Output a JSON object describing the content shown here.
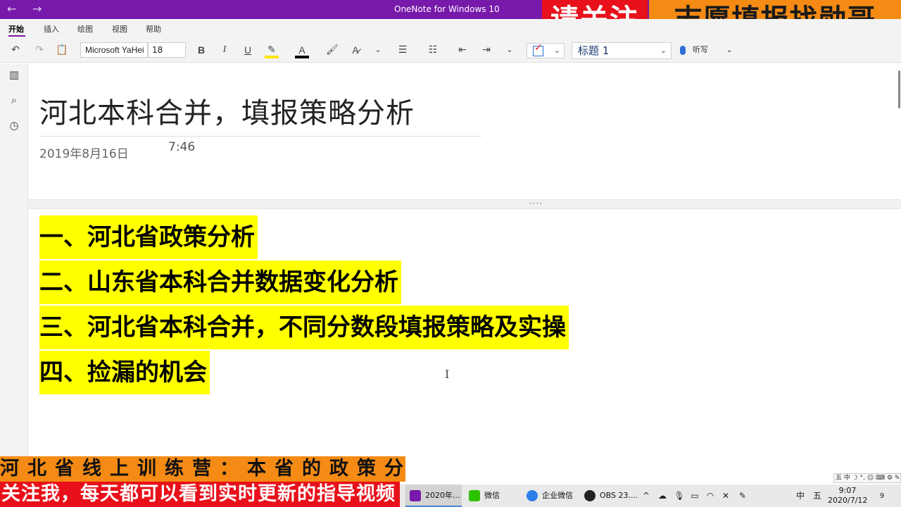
{
  "titlebar": {
    "back_icon": "←",
    "forward_icon": "→",
    "app_title": "OneNote for Windows 10"
  },
  "overlay": {
    "red_text": "请关注",
    "orange_text": "志愿填报找勋哥",
    "red_color": "#e8101a",
    "orange_color": "#f58b14"
  },
  "ribbon": {
    "tabs": [
      "开始",
      "插入",
      "绘图",
      "视图",
      "帮助"
    ],
    "active_tab": "开始",
    "font_name": "Microsoft YaHei",
    "font_size": "18",
    "bold_label": "B",
    "italic_label": "I",
    "underline_label": "U",
    "font_color_label": "A",
    "style_value": "标题 1",
    "dictate_label": "听写"
  },
  "page": {
    "title": "河北本科合并，填报策略分析",
    "date": "2019年8月16日",
    "time": "7:46",
    "outline": [
      "一、河北省政策分析",
      "二、山东省本科合并数据变化分析",
      "三、河北省本科合并，不同分数段填报策略及实操",
      "四、捡漏的机会"
    ],
    "highlight_color": "#ffff00"
  },
  "banners": {
    "top": "河北省线上训练营：本省的政策分析",
    "bottom": "关注我，每天都可以看到实时更新的指导视频"
  },
  "taskbar": {
    "items": [
      {
        "label": "2020年...",
        "icon": "onenote-icon"
      },
      {
        "label": "微信",
        "icon": "wechat-icon"
      },
      {
        "label": "企业微信",
        "icon": "wecom-icon"
      },
      {
        "label": "OBS 23....",
        "icon": "obs-icon"
      }
    ],
    "tray": [
      "^",
      "中",
      "五"
    ],
    "time": "9:07",
    "date": "2020/7/12",
    "notification_count": "9",
    "ime_bar": "五 中 ☽ °, ☺ ⌨ ⚙ ✎ ☰"
  }
}
